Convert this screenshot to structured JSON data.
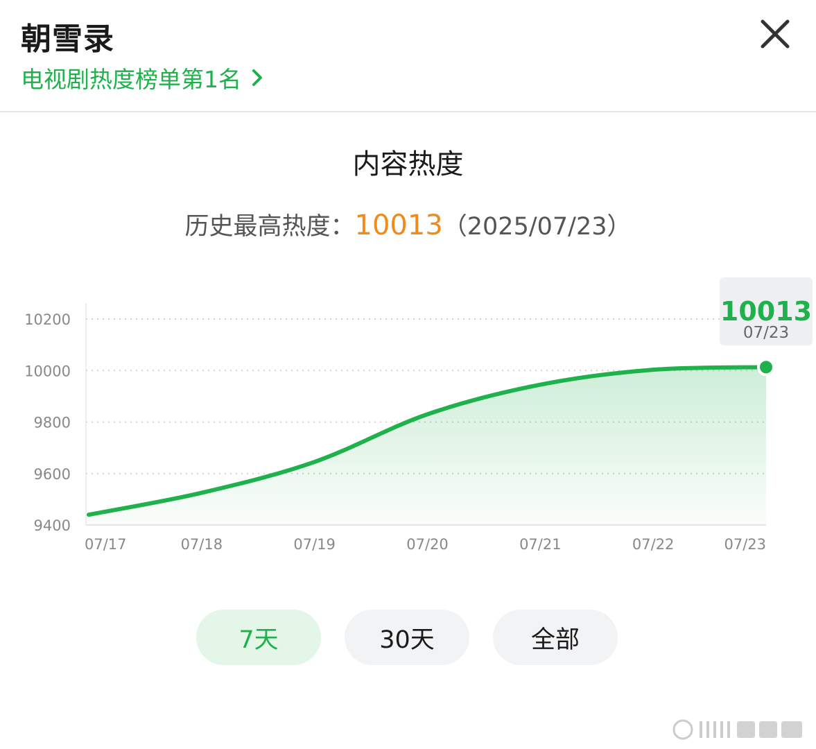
{
  "header": {
    "title": "朝雪录",
    "rank_link": "电视剧热度榜单第1名"
  },
  "section": {
    "title": "内容热度",
    "peak_label": "历史最高热度：",
    "peak_value": "10013",
    "peak_date": "（2025/07/23）"
  },
  "tooltip": {
    "value": "10013",
    "date": "07/23"
  },
  "tabs": [
    {
      "label": "7天",
      "active": true
    },
    {
      "label": "30天",
      "active": false
    },
    {
      "label": "全部",
      "active": false
    }
  ],
  "colors": {
    "accent": "#1fb14b",
    "peak": "#f08a1c"
  },
  "icons": {
    "close": "close-icon",
    "chevron": "chevron-right-icon"
  },
  "chart_data": {
    "type": "area",
    "x": [
      "07/17",
      "07/18",
      "07/19",
      "07/20",
      "07/21",
      "07/22",
      "07/23"
    ],
    "series": [
      {
        "values": [
          9440,
          9525,
          9645,
          9830,
          9945,
          10003,
          10013
        ]
      }
    ],
    "yticks": [
      "10200",
      "10000",
      "9800",
      "9600",
      "9400"
    ],
    "ylim": [
      9400,
      10200
    ],
    "grid": true
  }
}
